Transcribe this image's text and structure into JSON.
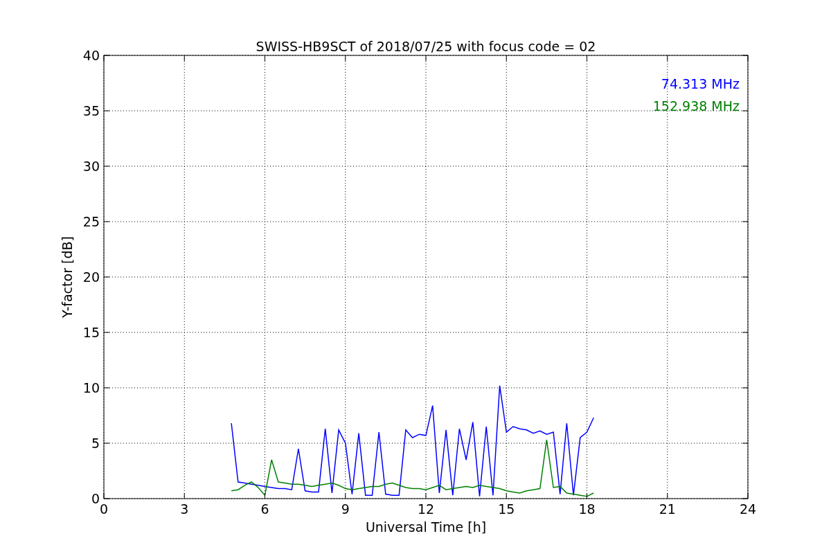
{
  "chart_data": {
    "type": "line",
    "title": "SWISS-HB9SCT of 2018/07/25 with focus code = 02",
    "xlabel": "Universal Time [h]",
    "ylabel": "Y-factor [dB]",
    "xlim": [
      0,
      24
    ],
    "ylim": [
      0,
      40
    ],
    "xticks": [
      0,
      3,
      6,
      9,
      12,
      15,
      18,
      21,
      24
    ],
    "yticks": [
      0,
      5,
      10,
      15,
      20,
      25,
      30,
      35,
      40
    ],
    "grid": true,
    "x": [
      4.75,
      5,
      5.25,
      5.5,
      5.75,
      6,
      6.25,
      6.5,
      6.75,
      7,
      7.25,
      7.5,
      7.75,
      8,
      8.25,
      8.5,
      8.75,
      9,
      9.25,
      9.5,
      9.75,
      10,
      10.25,
      10.5,
      10.75,
      11,
      11.25,
      11.5,
      11.75,
      12,
      12.25,
      12.5,
      12.75,
      13,
      13.25,
      13.5,
      13.75,
      14,
      14.25,
      14.5,
      14.75,
      15,
      15.25,
      15.5,
      15.75,
      16,
      16.25,
      16.5,
      16.75,
      17,
      17.25,
      17.5,
      17.75,
      18,
      18.25
    ],
    "series": [
      {
        "name": "74.313 MHz",
        "color": "#0000ff",
        "values": [
          6.8,
          1.5,
          1.4,
          1.3,
          1.2,
          1.1,
          1.0,
          0.9,
          0.9,
          0.8,
          4.5,
          0.7,
          0.6,
          0.6,
          6.3,
          0.5,
          6.2,
          5.0,
          0.4,
          5.9,
          0.3,
          0.3,
          6.0,
          0.4,
          0.3,
          0.3,
          6.2,
          5.5,
          5.8,
          5.7,
          8.4,
          0.5,
          6.2,
          0.3,
          6.3,
          3.5,
          6.9,
          0.2,
          6.5,
          0.3,
          10.2,
          6.0,
          6.5,
          6.3,
          6.2,
          5.9,
          6.1,
          5.8,
          6.0,
          0.4,
          6.8,
          0.3,
          5.5,
          6.0,
          7.3
        ]
      },
      {
        "name": "152.938 MHz",
        "color": "#008000",
        "values": [
          0.7,
          0.8,
          1.2,
          1.5,
          1.0,
          0.3,
          3.5,
          1.5,
          1.4,
          1.3,
          1.3,
          1.2,
          1.1,
          1.2,
          1.3,
          1.4,
          1.2,
          0.9,
          0.8,
          0.9,
          1.0,
          1.1,
          1.1,
          1.3,
          1.4,
          1.2,
          1.0,
          0.9,
          0.9,
          0.8,
          1.0,
          1.2,
          0.8,
          0.9,
          1.0,
          1.1,
          1.0,
          1.2,
          1.1,
          1.0,
          0.9,
          0.7,
          0.6,
          0.5,
          0.7,
          0.8,
          0.9,
          5.3,
          1.0,
          1.1,
          0.5,
          0.4,
          0.3,
          0.2,
          0.5
        ]
      }
    ]
  }
}
